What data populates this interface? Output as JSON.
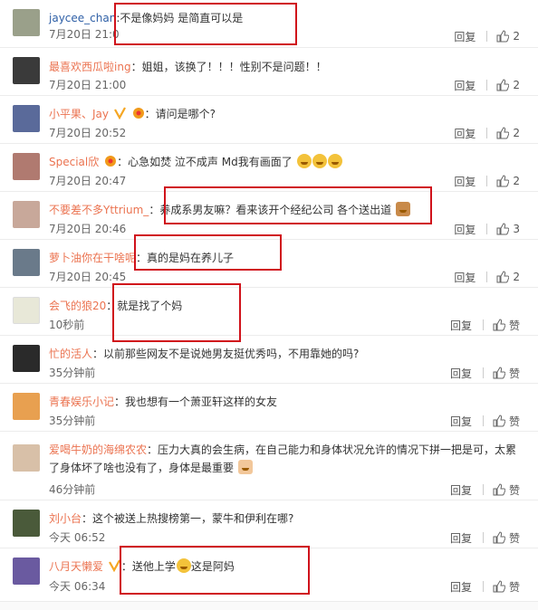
{
  "reply_label": "回复",
  "comments": [
    {
      "user": "jaycee_chan",
      "colon": ":",
      "text": "不是像妈妈 是简直可以是",
      "time": "7月20日 21:0",
      "likes": "2",
      "avatar_color": "#9aa08a"
    },
    {
      "user": "最喜欢西瓜啦ing",
      "colon": "：",
      "text": "姐姐，该换了！！！性别不是问题！！",
      "time": "7月20日 21:00",
      "likes": "2",
      "avatar_color": "#3a3a3a"
    },
    {
      "user": "小平果、Jay",
      "colon": "：",
      "text": "请问是哪个?",
      "time": "7月20日 20:52",
      "likes": "2",
      "avatar_color": "#5a6a9a"
    },
    {
      "user": "Special欣",
      "colon": "：",
      "text": "心急如焚 泣不成声 Md我有画面了",
      "time": "7月20日 20:47",
      "likes": "2",
      "avatar_color": "#b07a70"
    },
    {
      "user": "不要差不多Yttrium_",
      "colon": "：",
      "text": "养成系男友嘛？看来该开个经纪公司 各个送出道",
      "time": "7月20日 20:46",
      "likes": "3",
      "avatar_color": "#c8a89a"
    },
    {
      "user": "萝卜油你在干啥呢",
      "colon": "：",
      "text": "真的是妈在养儿子",
      "time": "7月20日 20:45",
      "likes": "2",
      "avatar_color": "#6a7a8a"
    },
    {
      "user": "会飞的狼20",
      "colon": "：",
      "text": "就是找了个妈",
      "time": "10秒前",
      "likes": "赞",
      "avatar_color": "#e8e8d8"
    },
    {
      "user": "忙的活人",
      "colon": "：",
      "text": "以前那些网友不是说她男友挺优秀吗，不用靠她的吗?",
      "time": "35分钟前",
      "likes": "赞",
      "avatar_color": "#2a2a2a"
    },
    {
      "user": "青春娱乐小记",
      "colon": "：",
      "text": "我也想有一个萧亚轩这样的女友",
      "time": "35分钟前",
      "likes": "赞",
      "avatar_color": "#e8a050"
    },
    {
      "user": "爱喝牛奶的海绵农农",
      "colon": "：",
      "text": "压力大真的会生病，在自己能力和身体状况允许的情况下拼一把是可，太累了身体坏了啥也没有了，身体是最重要",
      "time": "46分钟前",
      "likes": "赞",
      "avatar_color": "#d8c0a8"
    },
    {
      "user": "刘小台",
      "colon": "：",
      "text": "这个被送上热搜榜第一，蒙牛和伊利在哪?",
      "time": "今天 06:52",
      "likes": "赞",
      "avatar_color": "#4a5a3a"
    },
    {
      "user": "八月天懒爱",
      "colon": "：",
      "text": "送他上学",
      "text2": "这是阿妈",
      "time": "今天 06:34",
      "likes": "赞",
      "avatar_color": "#6a5aa0"
    }
  ]
}
